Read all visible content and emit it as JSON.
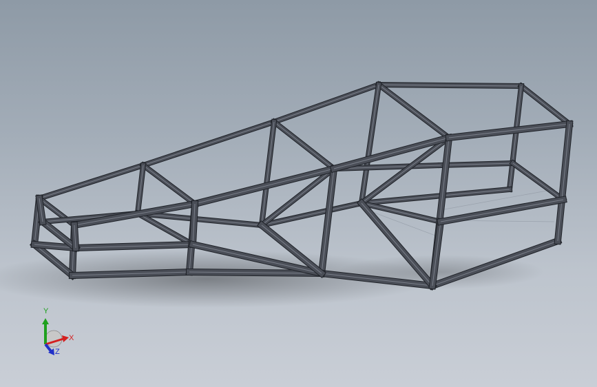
{
  "viewport": {
    "background_top": "#8e9aa6",
    "background_bottom": "#c9ced6",
    "model": "tubular-frame",
    "tube_color": "#4a4e57",
    "tube_edge_color": "#1f2228",
    "tube_highlight_color": "#7a7f8a"
  },
  "triad": {
    "x_label": "X",
    "y_label": "Y",
    "z_label": "Z",
    "x_color": "#d42020",
    "y_color": "#1ea01e",
    "z_color": "#2030c8"
  }
}
